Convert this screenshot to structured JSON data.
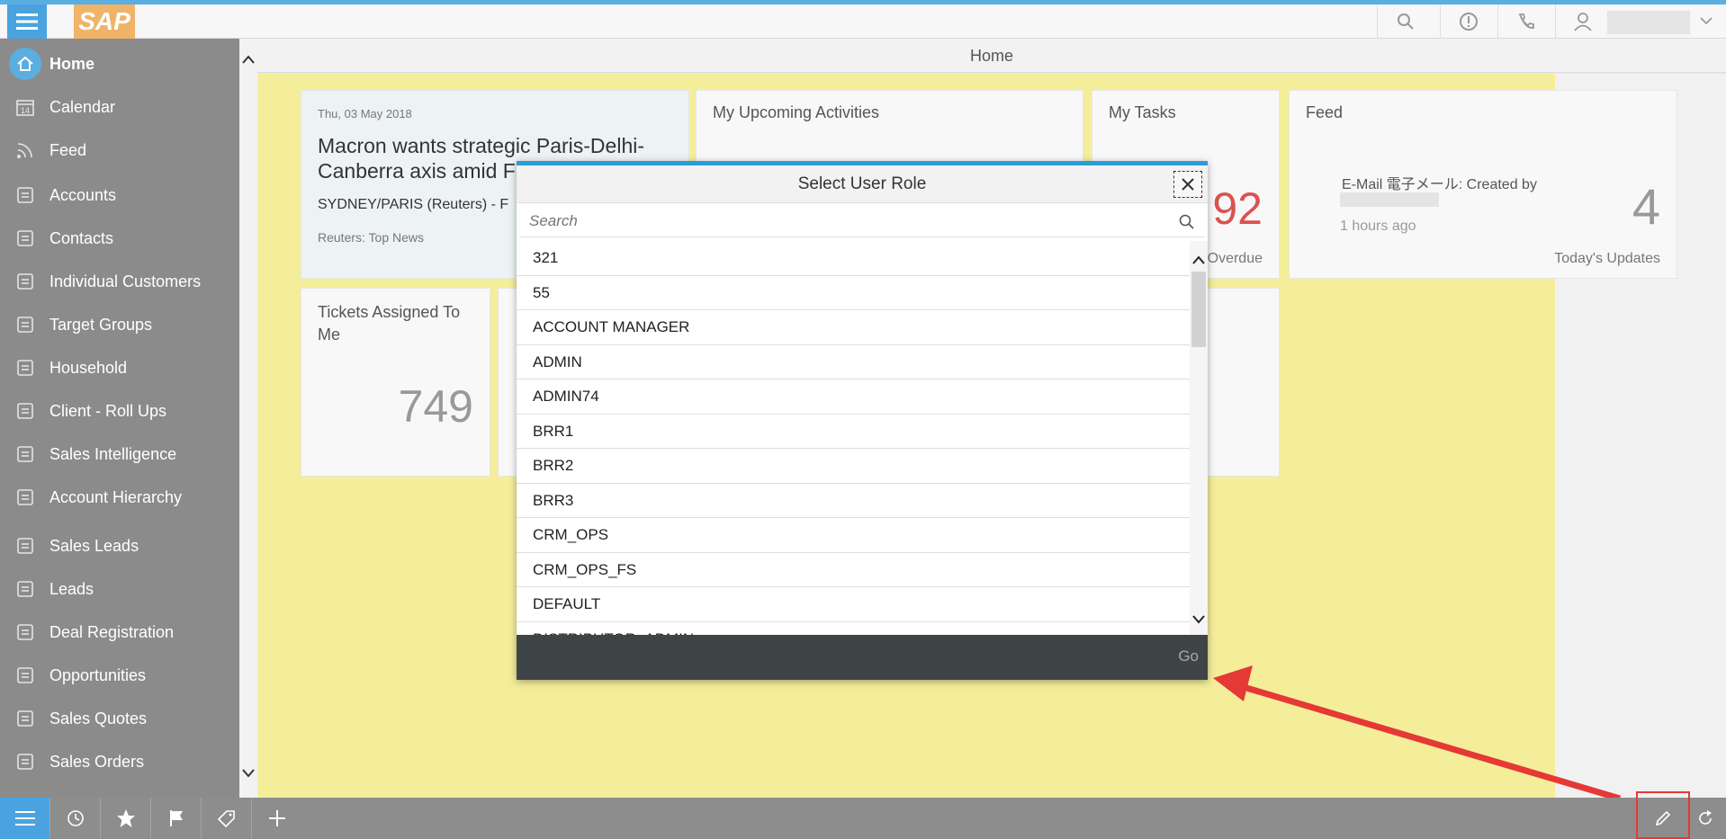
{
  "shell": {
    "logo": "SAP",
    "icons": [
      "menu-icon",
      "search-icon",
      "alert-icon",
      "phone-icon",
      "user-icon",
      "chevron-down-icon"
    ]
  },
  "sidebar": {
    "items": [
      {
        "label": "Home",
        "icon": "home-icon"
      },
      {
        "label": "Calendar",
        "icon": "calendar-icon"
      },
      {
        "label": "Feed",
        "icon": "feed-icon"
      },
      {
        "label": "Accounts",
        "icon": "accounts-icon"
      },
      {
        "label": "Contacts",
        "icon": "contacts-icon"
      },
      {
        "label": "Individual Customers",
        "icon": "person-icon"
      },
      {
        "label": "Target Groups",
        "icon": "target-icon"
      },
      {
        "label": "Household",
        "icon": "household-icon"
      },
      {
        "label": "Client - Roll Ups",
        "icon": "copy-icon"
      },
      {
        "label": "Sales Intelligence",
        "icon": "copy-icon"
      },
      {
        "label": "Account Hierarchy",
        "icon": "hierarchy-icon"
      },
      {
        "label": "Sales Leads",
        "icon": "dollar-icon"
      },
      {
        "label": "Leads",
        "icon": "lead-icon"
      },
      {
        "label": "Deal Registration",
        "icon": "registration-icon"
      },
      {
        "label": "Opportunities",
        "icon": "opportunity-icon"
      },
      {
        "label": "Sales Quotes",
        "icon": "quote-icon"
      },
      {
        "label": "Sales Orders",
        "icon": "order-icon"
      }
    ],
    "calendar_day": "14"
  },
  "main": {
    "title": "Home",
    "news": {
      "date": "Thu, 03 May 2018",
      "headline": "Macron wants strategic Paris-Delhi-Canberra axis amid F",
      "sub": "SYDNEY/PARIS (Reuters) - F",
      "source": "Reuters: Top News"
    },
    "upcoming": {
      "title": "My Upcoming Activities"
    },
    "tasks": {
      "title": "My Tasks",
      "value": "92",
      "label": "Overdue"
    },
    "feed": {
      "title": "Feed",
      "entry": "E-Mail 電子メール: Created by",
      "time": "1 hours ago",
      "value": "4",
      "label": "Today's Updates"
    },
    "tickets": {
      "title": "Tickets Assigned To Me",
      "value": "749"
    }
  },
  "dialog": {
    "title": "Select User Role",
    "search_placeholder": "Search",
    "roles": [
      "321",
      "55",
      "ACCOUNT MANAGER",
      "ADMIN",
      "ADMIN74",
      "BRR1",
      "BRR2",
      "BRR3",
      "CRM_OPS",
      "CRM_OPS_FS",
      "DEFAULT",
      "DISTRIBUTOR_ADMIN"
    ],
    "go_label": "Go"
  },
  "colors": {
    "accent": "#4aa3df",
    "sidebar": "#8b8b8b",
    "home_bg": "#f4ee9b",
    "overdue": "#d9534f",
    "arrow": "#e53935"
  }
}
